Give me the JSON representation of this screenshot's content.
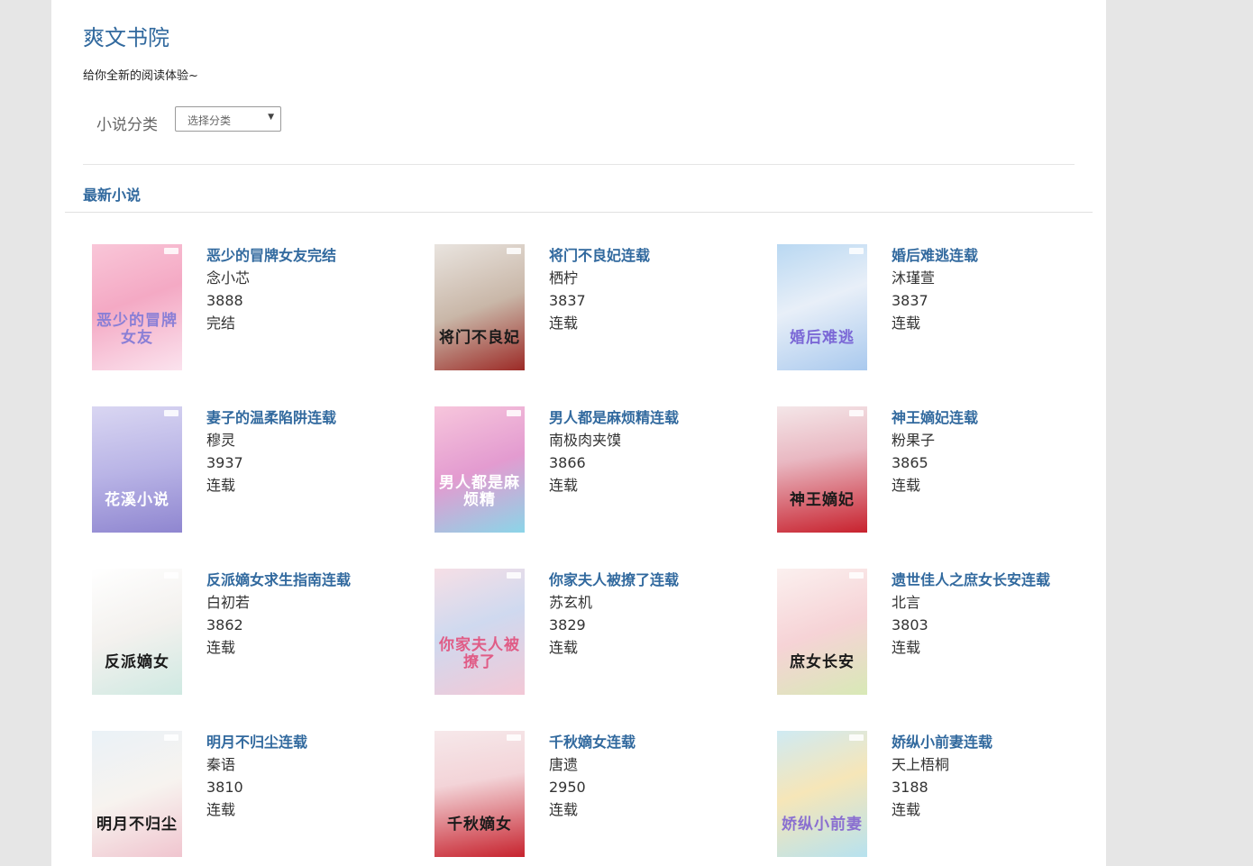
{
  "site": {
    "title": "爽文书院",
    "tagline": "给你全新的阅读体验~"
  },
  "filter": {
    "label": "小说分类",
    "select_value": "选择分类"
  },
  "section_title": "最新小说",
  "colors": {
    "accent": "#31699e",
    "background": "#e6e6e6",
    "page": "#ffffff"
  },
  "books": [
    {
      "title": "恶少的冒牌女友完结",
      "author": "念小芯",
      "count": "3888",
      "status": "完结",
      "cover_text": "恶少的冒牌女友",
      "cover_bg": "linear-gradient(160deg,#f9c6d8,#f4a9c4 45%,#fbe3ee)",
      "cover_fg": "#8a7fd6"
    },
    {
      "title": "将门不良妃连载",
      "author": "栖柠",
      "count": "3837",
      "status": "连载",
      "cover_text": "将门不良妃",
      "cover_bg": "linear-gradient(160deg,#e9e4df,#c9b7a8 50%,#9c2a26)",
      "cover_fg": "#1a1a1a"
    },
    {
      "title": "婚后难逃连载",
      "author": "沐瑾萱",
      "count": "3837",
      "status": "连载",
      "cover_text": "婚后难逃",
      "cover_bg": "linear-gradient(160deg,#b9d8f2,#e8eff8 45%,#a9c9ee)",
      "cover_fg": "#7b68d6"
    },
    {
      "title": "妻子的温柔陷阱连载",
      "author": "穆灵",
      "count": "3937",
      "status": "连载",
      "cover_text": "花溪小说",
      "cover_bg": "linear-gradient(170deg,#d9d6f2,#b9b4e6 50%,#8f86d0)",
      "cover_fg": "#ffffff"
    },
    {
      "title": "男人都是麻烦精连载",
      "author": "南极肉夹馍",
      "count": "3866",
      "status": "连载",
      "cover_text": "男人都是麻烦精",
      "cover_bg": "linear-gradient(160deg,#f7c6dc,#e39bd0 50%,#8bd5e8)",
      "cover_fg": "#ffffff"
    },
    {
      "title": "神王嫡妃连载",
      "author": "粉果子",
      "count": "3865",
      "status": "连载",
      "cover_text": "神王嫡妃",
      "cover_bg": "linear-gradient(170deg,#f4e6e8,#e9b8c2 40%,#c8222e)",
      "cover_fg": "#1a1a1a"
    },
    {
      "title": "反派嫡女求生指南连载",
      "author": "白初若",
      "count": "3862",
      "status": "连载",
      "cover_text": "反派嫡女",
      "cover_bg": "linear-gradient(160deg,#ffffff,#f3f1ee 50%,#cfe9e2)",
      "cover_fg": "#1a1a1a"
    },
    {
      "title": "你家夫人被撩了连载",
      "author": "苏玄机",
      "count": "3829",
      "status": "连载",
      "cover_text": "你家夫人被撩了",
      "cover_bg": "linear-gradient(160deg,#f6dfe6,#cfd9ef 45%,#f3c8d6)",
      "cover_fg": "#e05c86"
    },
    {
      "title": "遗世佳人之庶女长安连载",
      "author": "北言",
      "count": "3803",
      "status": "连载",
      "cover_text": "庶女长安",
      "cover_bg": "linear-gradient(160deg,#fbf0ef,#f6d3d6 50%,#d8e9b6)",
      "cover_fg": "#1a1a1a"
    },
    {
      "title": "明月不归尘连载",
      "author": "秦语",
      "count": "3810",
      "status": "连载",
      "cover_text": "明月不归尘",
      "cover_bg": "linear-gradient(160deg,#eaf2f7,#f7f3ef 50%,#f0c5cf)",
      "cover_fg": "#1a1a1a"
    },
    {
      "title": "千秋嫡女连载",
      "author": "唐遗",
      "count": "2950",
      "status": "连载",
      "cover_text": "千秋嫡女",
      "cover_bg": "linear-gradient(170deg,#f6e8ea,#f3d4d8 40%,#c7232e)",
      "cover_fg": "#1a1a1a"
    },
    {
      "title": "娇纵小前妻连载",
      "author": "天上梧桐",
      "count": "3188",
      "status": "连载",
      "cover_text": "娇纵小前妻",
      "cover_bg": "linear-gradient(160deg,#cfeaf3,#f6e6b8 45%,#b7e2ef)",
      "cover_fg": "#8a6fd0"
    }
  ]
}
